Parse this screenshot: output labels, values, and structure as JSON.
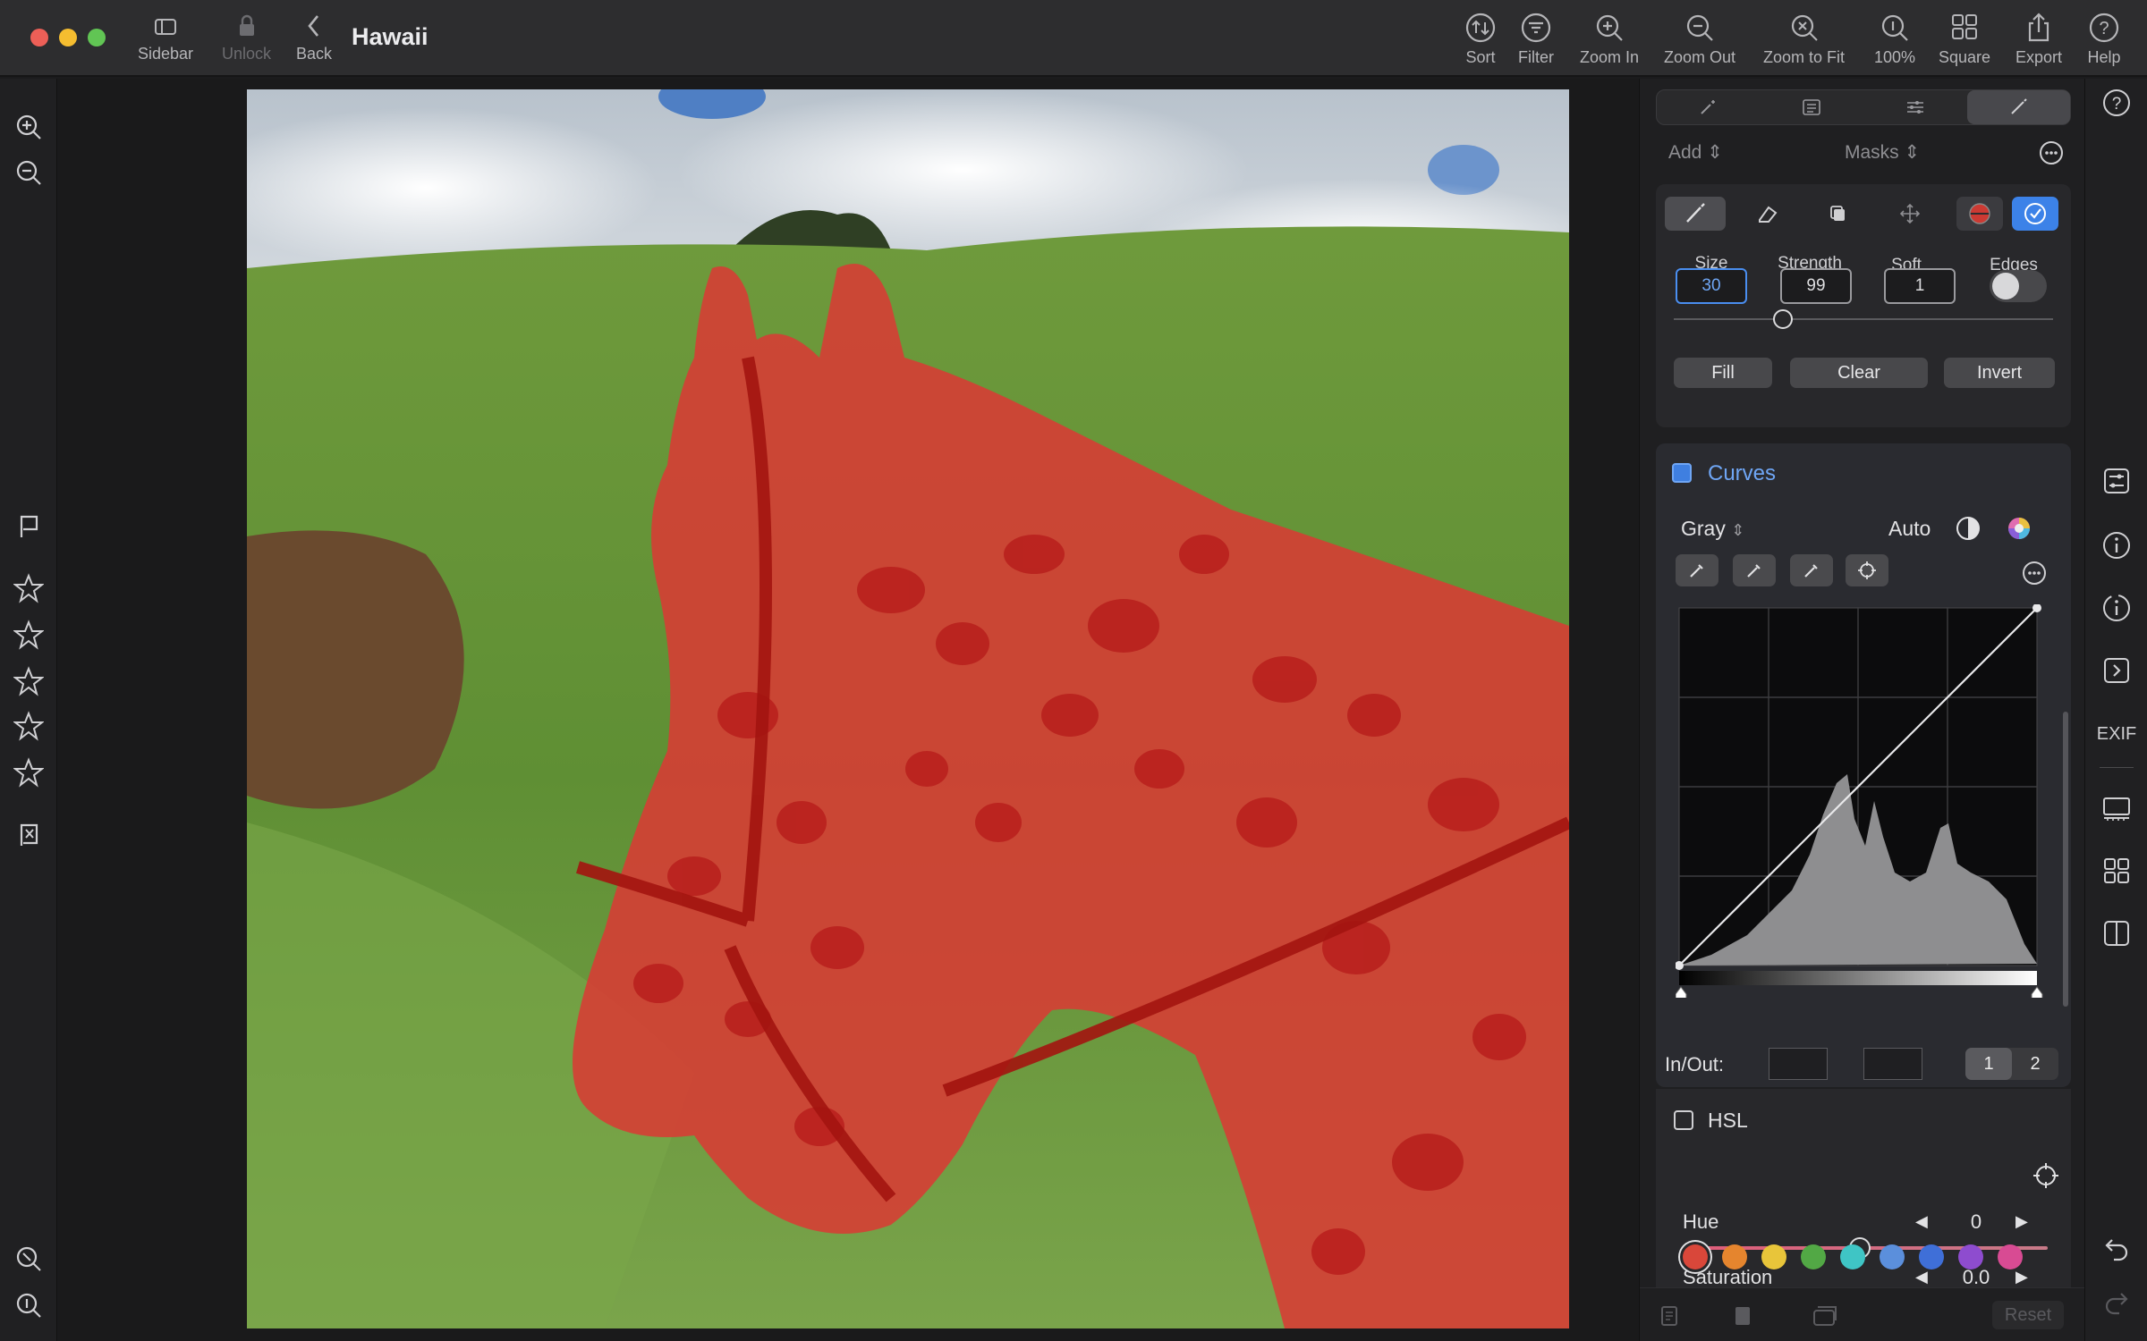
{
  "window": {
    "title": "Hawaii"
  },
  "toolbar": {
    "sidebar": "Sidebar",
    "unlock": "Unlock",
    "back": "Back",
    "sort": "Sort",
    "filter": "Filter",
    "zoom_in": "Zoom In",
    "zoom_out": "Zoom Out",
    "zoom_to_fit": "Zoom to Fit",
    "zoom_100": "100%",
    "square": "Square",
    "export": "Export",
    "help": "Help"
  },
  "inspector": {
    "add_label": "Add",
    "masks_label": "Masks",
    "brush": {
      "size_label": "Size",
      "size_value": "30",
      "strength_label": "Strength",
      "strength_value": "99",
      "soft_label": "Soft",
      "soft_value": "1",
      "edges_label": "Edges",
      "fill_label": "Fill",
      "clear_label": "Clear",
      "invert_label": "Invert"
    },
    "curves": {
      "title": "Curves",
      "channel": "Gray",
      "auto_label": "Auto",
      "inout_label": "In/Out:",
      "curve_btn_1": "1",
      "curve_btn_2": "2"
    },
    "hsl": {
      "title": "HSL",
      "hue_label": "Hue",
      "hue_value": "0",
      "saturation_label": "Saturation",
      "saturation_value": "0.0",
      "swatches": [
        "#d9473a",
        "#e5852e",
        "#e8c53a",
        "#52a845",
        "#3fc5c5",
        "#5b8fdc",
        "#3f6fd8",
        "#8e4ccf",
        "#d84b93"
      ]
    },
    "reset_label": "Reset"
  },
  "sidebar_right": {
    "exif_label": "EXIF"
  },
  "colors": {
    "accent": "#4a8ef0",
    "mask_red": "#d8302a"
  }
}
